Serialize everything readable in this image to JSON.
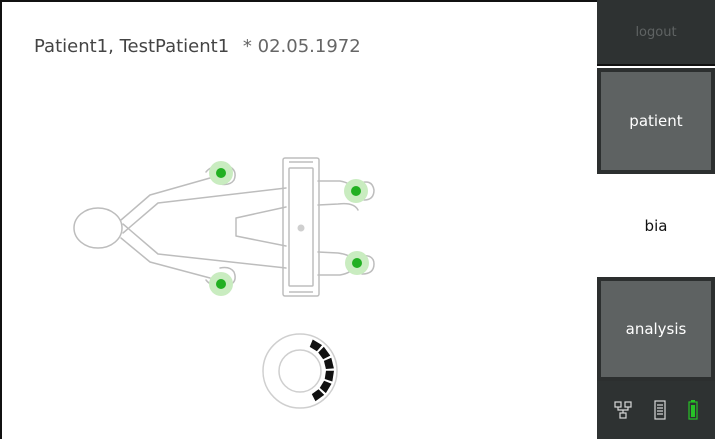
{
  "header": {
    "patient_name": "Patient1, TestPatient1",
    "dob": "* 02.05.1972"
  },
  "sidebar": {
    "logout_label": "logout",
    "patient_label": "patient",
    "bia_label": "bia",
    "analysis_label": "analysis"
  },
  "status_icons": [
    "network-icon",
    "scale-icon",
    "battery-icon"
  ],
  "colors": {
    "electrode_green": "#22b022",
    "battery_green": "#27c227"
  },
  "measurement_progress": 0.35
}
